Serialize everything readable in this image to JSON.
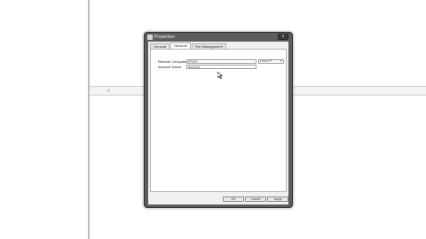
{
  "window": {
    "title": "Properties",
    "close_symbol": "x"
  },
  "tabs": [
    {
      "label": "General",
      "active": false
    },
    {
      "label": "Network",
      "active": true
    },
    {
      "label": "File Management",
      "active": false
    }
  ],
  "form": {
    "remote_computer_label": "Remote Computer",
    "remote_computer_value": "PROFI",
    "account_name_label": "Account Name",
    "account_name_value": "Account",
    "select_value": "Linux-FF"
  },
  "buttons": {
    "ok": "OK",
    "cancel": "Cancel",
    "apply": "Apply"
  },
  "icons": {
    "window_icon": "app-icon",
    "cursor": "mouse-pointer-icon"
  }
}
